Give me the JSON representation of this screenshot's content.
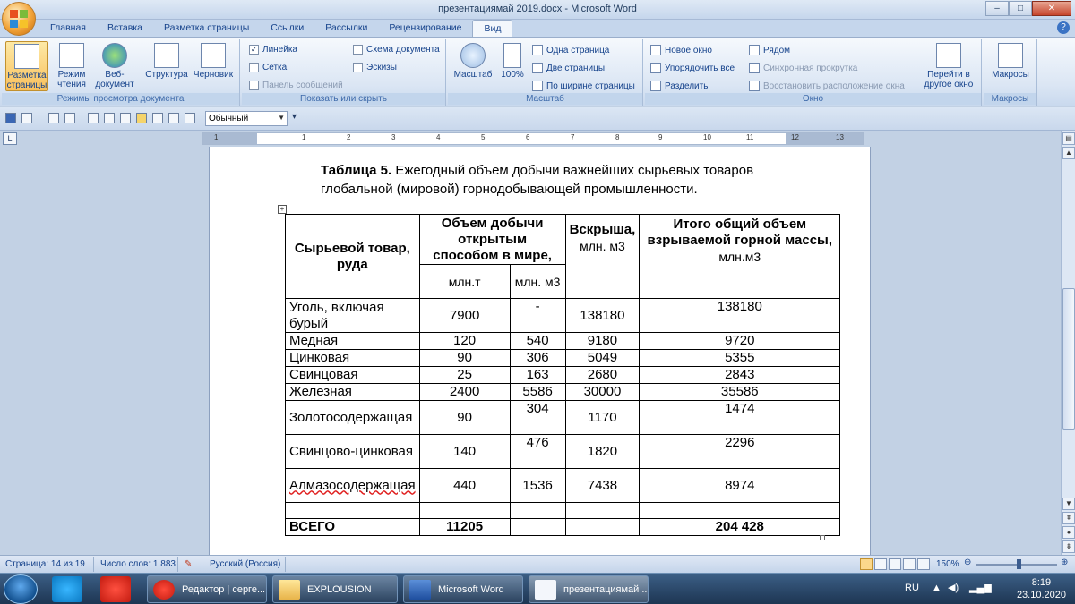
{
  "window": {
    "title": "презентациямай 2019.docx - Microsoft Word",
    "controls": {
      "minimize": "–",
      "maximize": "□",
      "close": "✕"
    }
  },
  "tabs": [
    "Главная",
    "Вставка",
    "Разметка страницы",
    "Ссылки",
    "Рассылки",
    "Рецензирование",
    "Вид"
  ],
  "active_tab": "Вид",
  "ribbon": {
    "view_modes": {
      "label": "Режимы просмотра документа",
      "buttons": [
        {
          "label": "Разметка страницы",
          "active": true
        },
        {
          "label": "Режим чтения"
        },
        {
          "label": "Веб-документ"
        },
        {
          "label": "Структура"
        },
        {
          "label": "Черновик"
        }
      ]
    },
    "show_hide": {
      "label": "Показать или скрыть",
      "ruler": "Линейка",
      "grid": "Сетка",
      "message_bar": "Панель сообщений",
      "doc_map": "Схема документа",
      "thumbnails": "Эскизы"
    },
    "zoom": {
      "label": "Масштаб",
      "zoom_btn": "Масштаб",
      "percent_btn": "100%",
      "one_page": "Одна страница",
      "two_pages": "Две страницы",
      "page_width": "По ширине страницы"
    },
    "window": {
      "label": "Окно",
      "new_window": "Новое окно",
      "arrange_all": "Упорядочить все",
      "split": "Разделить",
      "side_by_side": "Рядом",
      "sync_scroll": "Синхронная прокрутка",
      "reset_position": "Восстановить расположение окна",
      "switch_windows": "Перейти в другое окно"
    },
    "macros": {
      "label": "Макросы",
      "button": "Макросы"
    }
  },
  "qat": {
    "style": "Обычный"
  },
  "ruler": {
    "numbers": [
      "1",
      "1",
      "2",
      "3",
      "4",
      "5",
      "6",
      "7",
      "8",
      "9",
      "10",
      "11",
      "12",
      "13"
    ]
  },
  "document": {
    "caption_bold": "Таблица 5.",
    "caption_text": " Ежегодный объем добычи важнейших сырьевых товаров глобальной (мировой) горнодобывающей промышленности.",
    "table": {
      "headers": {
        "commodity": "Сырьевой товар, руда",
        "open_pit": "Объем добычи открытым способом в мире,",
        "open_pit_t": "млн.т",
        "open_pit_m3": "млн. м3",
        "stripping": "Вскрыша,",
        "stripping_unit": "млн. м3",
        "total": "Итого общий объем взрываемой горной массы,",
        "total_unit": "млн.м3"
      },
      "rows": [
        {
          "name": "Уголь, включая бурый",
          "t": "7900",
          "m3": "-",
          "strip": "138180",
          "total": "138180"
        },
        {
          "name": "Медная",
          "t": "120",
          "m3": "540",
          "strip": "9180",
          "total": "9720"
        },
        {
          "name": "Цинковая",
          "t": "90",
          "m3": "306",
          "strip": "5049",
          "total": "5355"
        },
        {
          "name": "Свинцовая",
          "t": "25",
          "m3": "163",
          "strip": "2680",
          "total": "2843"
        },
        {
          "name": "Железная",
          "t": "2400",
          "m3": "5586",
          "strip": "30000",
          "total": "35586"
        },
        {
          "name": "Золотосодержащая",
          "t": "90",
          "m3": "304",
          "strip": "1170",
          "total": "1474"
        },
        {
          "name": "Свинцово-цинковая",
          "t": "140",
          "m3": "476",
          "strip": "1820",
          "total": "2296"
        },
        {
          "name": "Алмазосодержащая",
          "t": "440",
          "m3": "1536",
          "strip": "7438",
          "total": "8974"
        }
      ],
      "total_row": {
        "name": "ВСЕГО",
        "t": "11205",
        "m3": "",
        "strip": "",
        "total": "204 428"
      }
    }
  },
  "status": {
    "page": "Страница: 14 из 19",
    "words": "Число слов: 1 883",
    "language": "Русский (Россия)",
    "zoom": "150%"
  },
  "taskbar": {
    "items": [
      "Редактор | серге...",
      "EXPLOUSION",
      "Microsoft Word",
      "презентациямай ..."
    ],
    "lang": "RU",
    "time": "8:19",
    "date": "23.10.2020"
  }
}
